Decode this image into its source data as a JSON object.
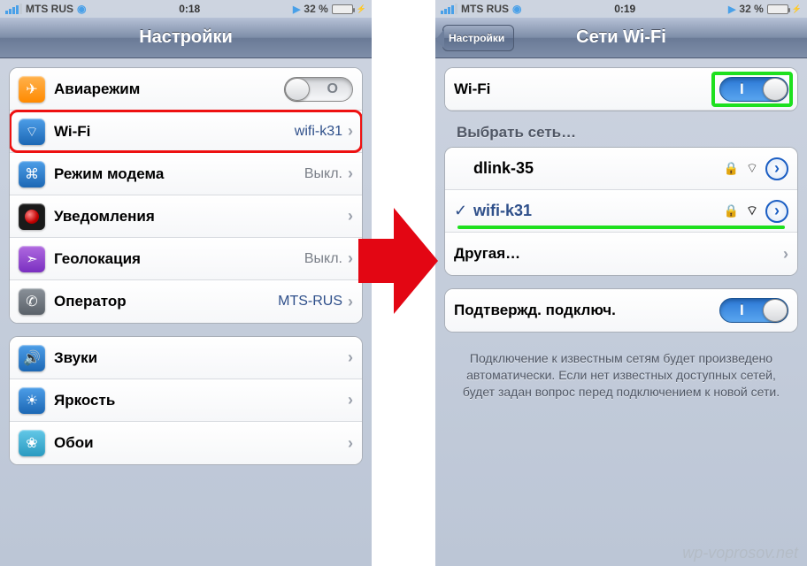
{
  "left": {
    "status": {
      "carrier": "MTS RUS",
      "time": "0:18",
      "battery": "32 %"
    },
    "nav": {
      "title": "Настройки"
    },
    "g1": [
      {
        "icon": "airplane-icon",
        "label": "Авиарежим",
        "toggle": "off"
      },
      {
        "icon": "wifi-icon",
        "label": "Wi-Fi",
        "value": "wifi-k31",
        "hl": "red"
      },
      {
        "icon": "tether-icon",
        "label": "Режим модема",
        "value": "Выкл.",
        "gray": true
      },
      {
        "icon": "notif-icon",
        "label": "Уведомления"
      },
      {
        "icon": "location-icon",
        "label": "Геолокация",
        "value": "Выкл.",
        "gray": true
      },
      {
        "icon": "carrier-icon",
        "label": "Оператор",
        "value": "MTS-RUS"
      }
    ],
    "g2": [
      {
        "icon": "sounds-icon",
        "label": "Звуки"
      },
      {
        "icon": "bright-icon",
        "label": "Яркость"
      },
      {
        "icon": "wall-icon",
        "label": "Обои"
      }
    ]
  },
  "right": {
    "status": {
      "carrier": "MTS RUS",
      "time": "0:19",
      "battery": "32 %"
    },
    "nav": {
      "back": "Настройки",
      "title": "Сети Wi-Fi"
    },
    "wifi_row": {
      "label": "Wi-Fi"
    },
    "choose_head": "Выбрать сеть…",
    "nets": [
      {
        "name": "dlink-35",
        "checked": false,
        "locked": true,
        "bars": 2
      },
      {
        "name": "wifi-k31",
        "checked": true,
        "locked": true,
        "bars": 3,
        "hl": true
      }
    ],
    "other": "Другая…",
    "ask_row": {
      "label": "Подтвержд. подключ."
    },
    "note": "Подключение к известным сетям будет произведено автоматически. Если нет известных доступных сетей, будет задан вопрос перед подключением к новой сети."
  },
  "watermark": "wp-voprosov.net"
}
